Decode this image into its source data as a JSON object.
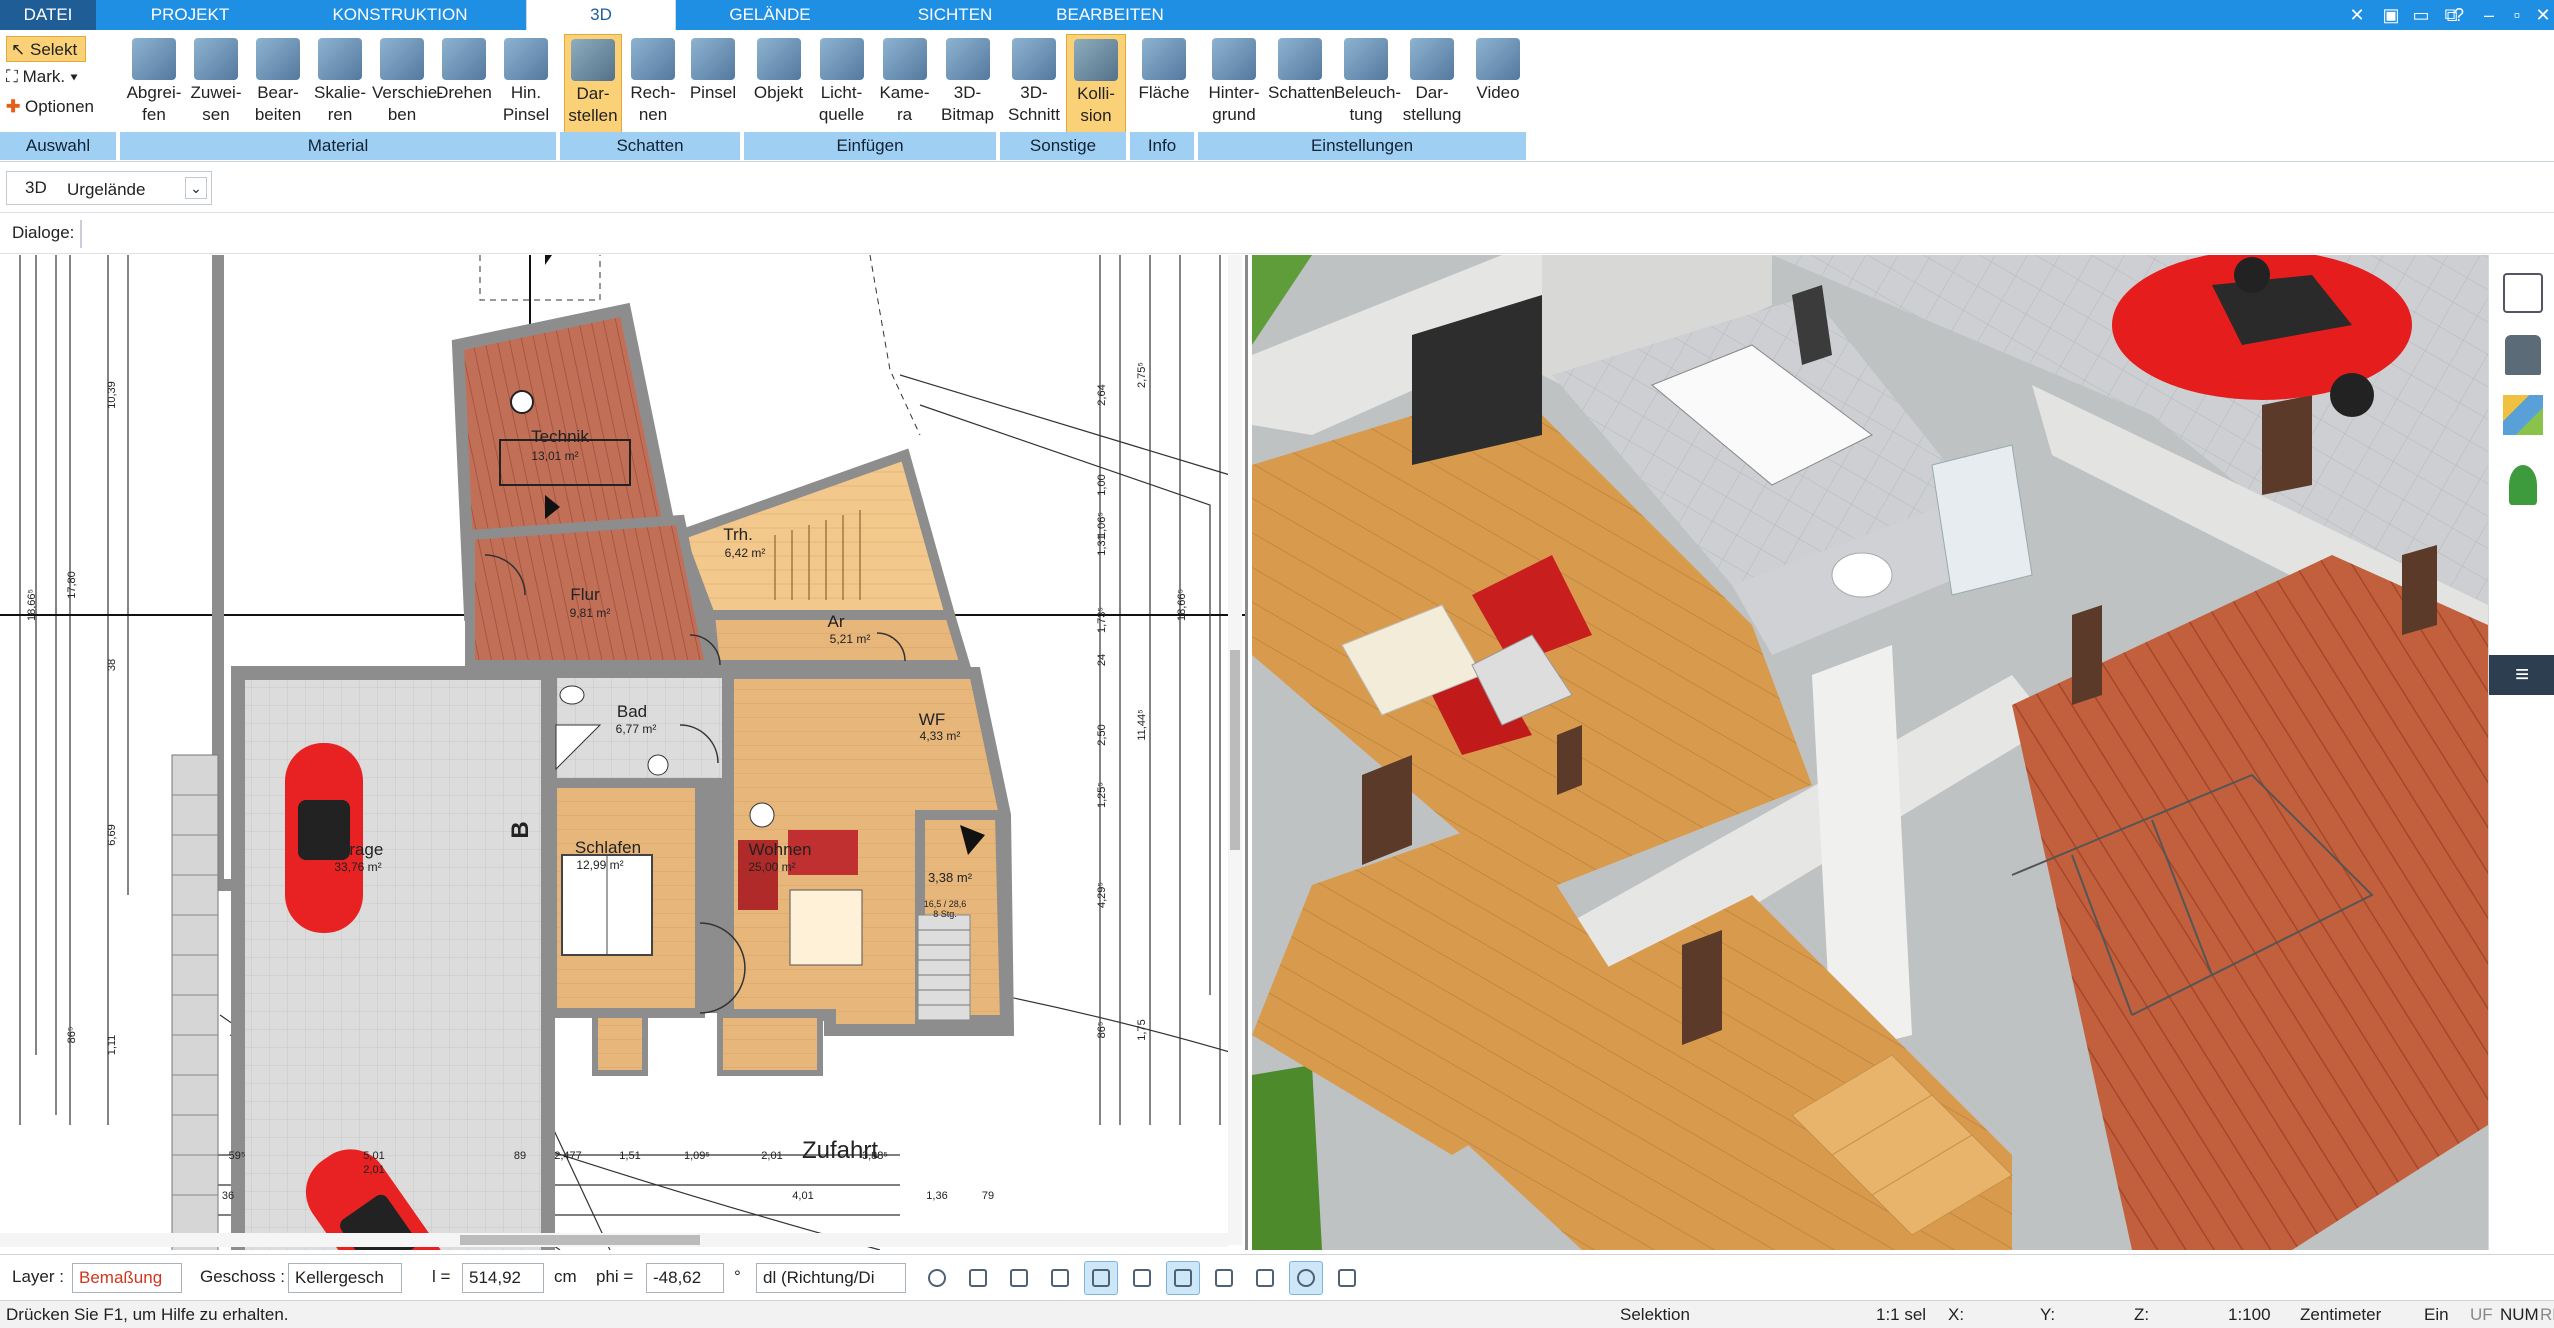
{
  "tabs": [
    {
      "label": "DATEI"
    },
    {
      "label": "PROJEKT"
    },
    {
      "label": "KONSTRUKTION"
    },
    {
      "label": "3D"
    },
    {
      "label": "GELÄNDE"
    },
    {
      "label": "SICHTEN"
    },
    {
      "label": "BEARBEITEN"
    }
  ],
  "auswahl": {
    "select": "Selekt",
    "mark": "Mark.",
    "options": "Optionen",
    "group": "Auswahl"
  },
  "material": {
    "group": "Material",
    "buttons": [
      "Abgrei-\nfen",
      "Zuwei-\nsen",
      "Bear-\nbeiten",
      "Skalie-\nren",
      "Verschie-\nben",
      "Drehen",
      "Hin.\nPinsel"
    ]
  },
  "schatten": {
    "group": "Schatten",
    "buttons": [
      "Dar-\nstellen",
      "Rech-\nnen",
      "Pinsel"
    ]
  },
  "einfuegen": {
    "group": "Einfügen",
    "buttons": [
      "Objekt",
      "Licht-\nquelle",
      "Kame-\nra",
      "3D-\nBitmap"
    ]
  },
  "sonstige": {
    "group": "Sonstige",
    "buttons": [
      "3D-\nSchnitt",
      "Kolli-\nsion"
    ]
  },
  "info": {
    "group": "Info",
    "buttons": [
      "Fläche"
    ]
  },
  "einstellungen": {
    "group": "Einstellungen",
    "buttons": [
      "Hinter-\ngrund",
      "Schatten",
      "Beleuch-\ntung",
      "Dar-\nstellung",
      "Video"
    ]
  },
  "view_selector": {
    "mode": "3D",
    "value": "Urgelände"
  },
  "dialoge_label": "Dialoge:",
  "plan": {
    "rooms": [
      {
        "name": "Technik",
        "area": "13,01 m²"
      },
      {
        "name": "Trh.",
        "area": "6,42 m²"
      },
      {
        "name": "Flur",
        "area": "9,81 m²"
      },
      {
        "name": "Ar",
        "area": "5,21 m²"
      },
      {
        "name": "Bad",
        "area": "6,77 m²"
      },
      {
        "name": "WF",
        "area": "4,33 m²"
      },
      {
        "name": "Garage",
        "area": "33,76 m²"
      },
      {
        "name": "Wohnen",
        "area": "25,00 m²"
      },
      {
        "name": "Schlafen",
        "area": "12,99 m²"
      },
      {
        "name": "",
        "area": "3,38 m²"
      }
    ],
    "street_label": "Zufahrt",
    "section_label": "B",
    "dims_left": [
      "10,39",
      "17,80",
      "18,66⁵",
      "6,69",
      "1,11",
      "86⁵",
      "38"
    ],
    "dims_right": [
      "2,64",
      "2,75⁵",
      "1,00",
      "1,31",
      "1,06⁵",
      "1,73⁵",
      "24",
      "2,50",
      "11,44⁵",
      "1,25⁵",
      "4,29⁵",
      "1,75",
      "86⁵",
      "18,66⁵"
    ],
    "dims_bottom": [
      "59⁵",
      "5,01",
      "2,01",
      "89",
      "2,477",
      "1,51",
      "1,09⁵",
      "2,01",
      "3,88⁵",
      "36",
      "4,01",
      "1,36",
      "79"
    ],
    "stair_note": "16,5 / 28,6",
    "stair_note2": "8 Stg."
  },
  "statusbar": {
    "layer_label": "Layer :",
    "layer_value": "Bemaßung",
    "geschoss_label": "Geschoss :",
    "geschoss_value": "Kellergesch",
    "l_label": "l =",
    "l_value": "514,92",
    "l_unit": "cm",
    "phi_label": "phi =",
    "phi_value": "-48,62",
    "phi_unit": "°",
    "dl_value": "dl (Richtung/Di"
  },
  "help": {
    "hint": "Drücken Sie F1, um Hilfe zu erhalten.",
    "mode": "Selektion",
    "sel": "1:1 sel",
    "x": "X:",
    "y": "Y:",
    "z": "Z:",
    "scale": "1:100",
    "unit": "Zentimeter",
    "ein": "Ein",
    "uf": "UF",
    "num": "NUM",
    "rf": "RF"
  },
  "colors": {
    "accent": "#1e8fe3",
    "selected": "#fbd177",
    "group_band": "#9fd0f4"
  }
}
